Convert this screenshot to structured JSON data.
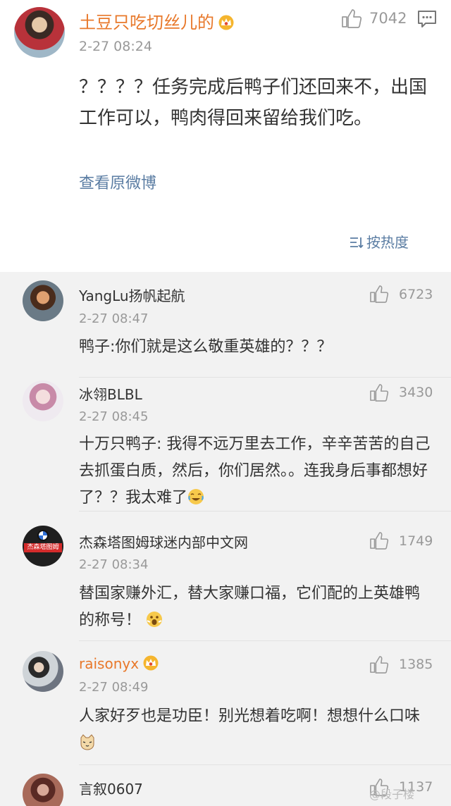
{
  "main_post": {
    "username": "土豆只吃切丝儿的",
    "timestamp": "2-27 08:24",
    "like_count": "7042",
    "text": "？？？？任务完成后鸭子们还回来不，出国工作可以，鸭肉得回来留给我们吃。",
    "view_original": "查看原微博",
    "sort_label": "按热度"
  },
  "comments": [
    {
      "username": "YangLu扬帆起航",
      "timestamp": "2-27 08:47",
      "likes": "6723",
      "text": "鸭子:你们就是这么敬重英雄的？？？"
    },
    {
      "username": "冰翎BLBL",
      "timestamp": "2-27 08:45",
      "likes": "3430",
      "text": "十万只鸭子: 我得不远万里去工作，辛辛苦苦的自己去抓蛋白质，然后，你们居然。。连我身后事都想好了？？我太难了"
    },
    {
      "username": "杰森塔图姆球迷内部中文网",
      "timestamp": "2-27 08:34",
      "likes": "1749",
      "text": "替国家赚外汇，替大家赚口福，它们配的上英雄鸭的称号！",
      "avatar_text": "杰森塔图姆"
    },
    {
      "username": "raisonyx",
      "timestamp": "2-27 08:49",
      "likes": "1385",
      "text": "人家好歹也是功臣！别光想着吃啊！想想什么口味"
    },
    {
      "username": "言叙0607",
      "likes": "1137"
    }
  ],
  "watermark": "@段子楼",
  "icons": {
    "like": "thumbs-up-icon",
    "message": "message-icon",
    "sort": "sort-icon",
    "crown": "vip-crown-icon"
  },
  "colors": {
    "vip_name": "#e8782a",
    "link": "#5b7da3",
    "meta": "#999999",
    "background": "#f2f2f2"
  }
}
